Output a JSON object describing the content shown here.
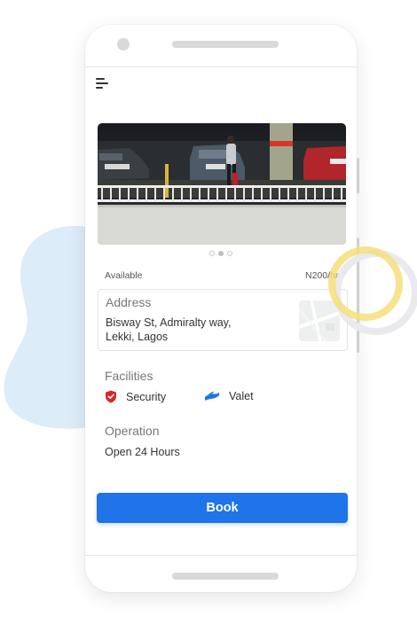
{
  "listing": {
    "availability": "Available",
    "price": "N200/hr"
  },
  "carousel": {
    "slides": 3,
    "active_slide": 2
  },
  "address": {
    "title": "Address",
    "line1": "Bisway St, Admiralty way,",
    "line2": "Lekki, Lagos"
  },
  "facilities": {
    "title": "Facilities",
    "items": [
      {
        "label": "Security",
        "icon": "shield-icon",
        "color": "#e02424"
      },
      {
        "label": "Valet",
        "icon": "hand-icon",
        "color": "#1e74e8"
      }
    ]
  },
  "operation": {
    "title": "Operation",
    "hours": "Open 24 Hours"
  },
  "actions": {
    "book_label": "Book"
  },
  "colors": {
    "primary": "#1e74e8",
    "security": "#e02424",
    "decor_blob": "#dcecf8",
    "decor_ring": "#f7de7a"
  }
}
